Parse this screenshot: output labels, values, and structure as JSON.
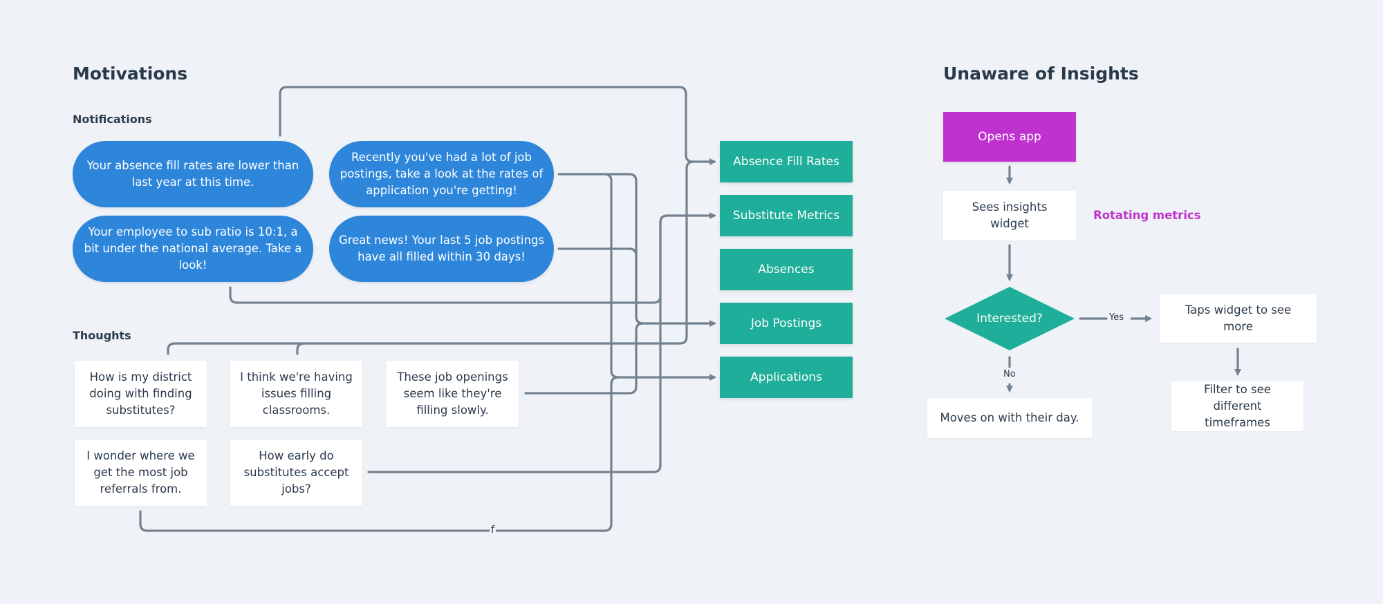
{
  "left": {
    "title": "Motivations",
    "notifications_label": "Notifications",
    "notifications": [
      "Your absence fill rates are lower than last year at this time.",
      "Recently you've had a lot of job postings, take a look at the rates of application you're getting!",
      "Your employee to sub ratio is 10:1, a bit under the national average. Take a look!",
      "Great news! Your last 5 job postings have all filled within 30 days!"
    ],
    "thoughts_label": "Thoughts",
    "thoughts": [
      "How is my district doing with finding substitutes?",
      "I think we're having issues filling classrooms.",
      "These job openings seem like they're filling slowly.",
      "I wonder where we get the most job referrals from.",
      "How early do substitutes accept jobs?"
    ],
    "stray_label": "f"
  },
  "targets": [
    "Absence Fill Rates",
    "Substitute Metrics",
    "Absences",
    "Job Postings",
    "Applications"
  ],
  "right": {
    "title": "Unaware of Insights",
    "opens_app": "Opens app",
    "sees_widget": "Sees insights widget",
    "rotating_metrics": "Rotating metrics",
    "decision": "Interested?",
    "yes_label": "Yes",
    "no_label": "No",
    "taps_widget": "Taps widget to see more",
    "moves_on": "Moves on with their day.",
    "filter": "Filter to see different timeframes"
  },
  "colors": {
    "background": "#eff3f7",
    "notification_pill": "#2e86db",
    "target_box": "#1fae99",
    "opens_app": "#c032d0",
    "rotating_metrics_text": "#c032d0",
    "connector": "#74818e",
    "text": "#2b3a4a"
  }
}
